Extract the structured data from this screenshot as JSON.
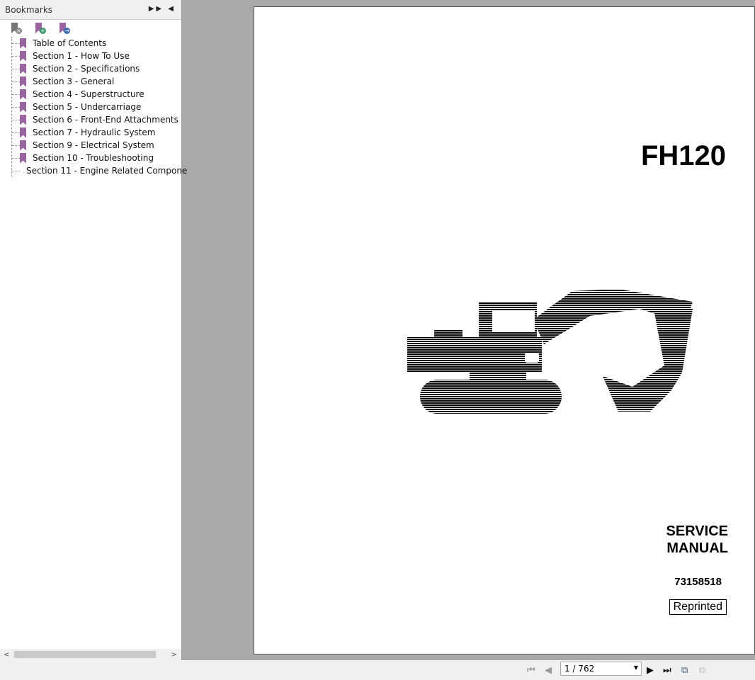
{
  "panel": {
    "title": "Bookmarks",
    "controls": [
      "expand-icon",
      "collapse-panel-icon"
    ],
    "tools": [
      "delete-bookmark-icon",
      "add-bookmark-icon",
      "go-to-bookmark-icon"
    ],
    "items": [
      "Table of Contents",
      "Section 1 - How To Use",
      "Section 2 - Specifications",
      "Section 3 - General",
      "Section 4 - Superstructure",
      "Section 5 - Undercarriage",
      "Section 6 - Front-End Attachments",
      "Section 7 - Hydraulic System",
      "Section 9 - Electrical System",
      "Section 10 - Troubleshooting",
      "Section 11 - Engine Related Compone"
    ]
  },
  "document": {
    "model": "FH120",
    "title_line1": "SERVICE",
    "title_line2": "MANUAL",
    "part_number": "73158518",
    "status": "Reprinted"
  },
  "nav": {
    "page_indicator": "1 / 762"
  },
  "colors": {
    "bookmark": "#9a64a0"
  }
}
